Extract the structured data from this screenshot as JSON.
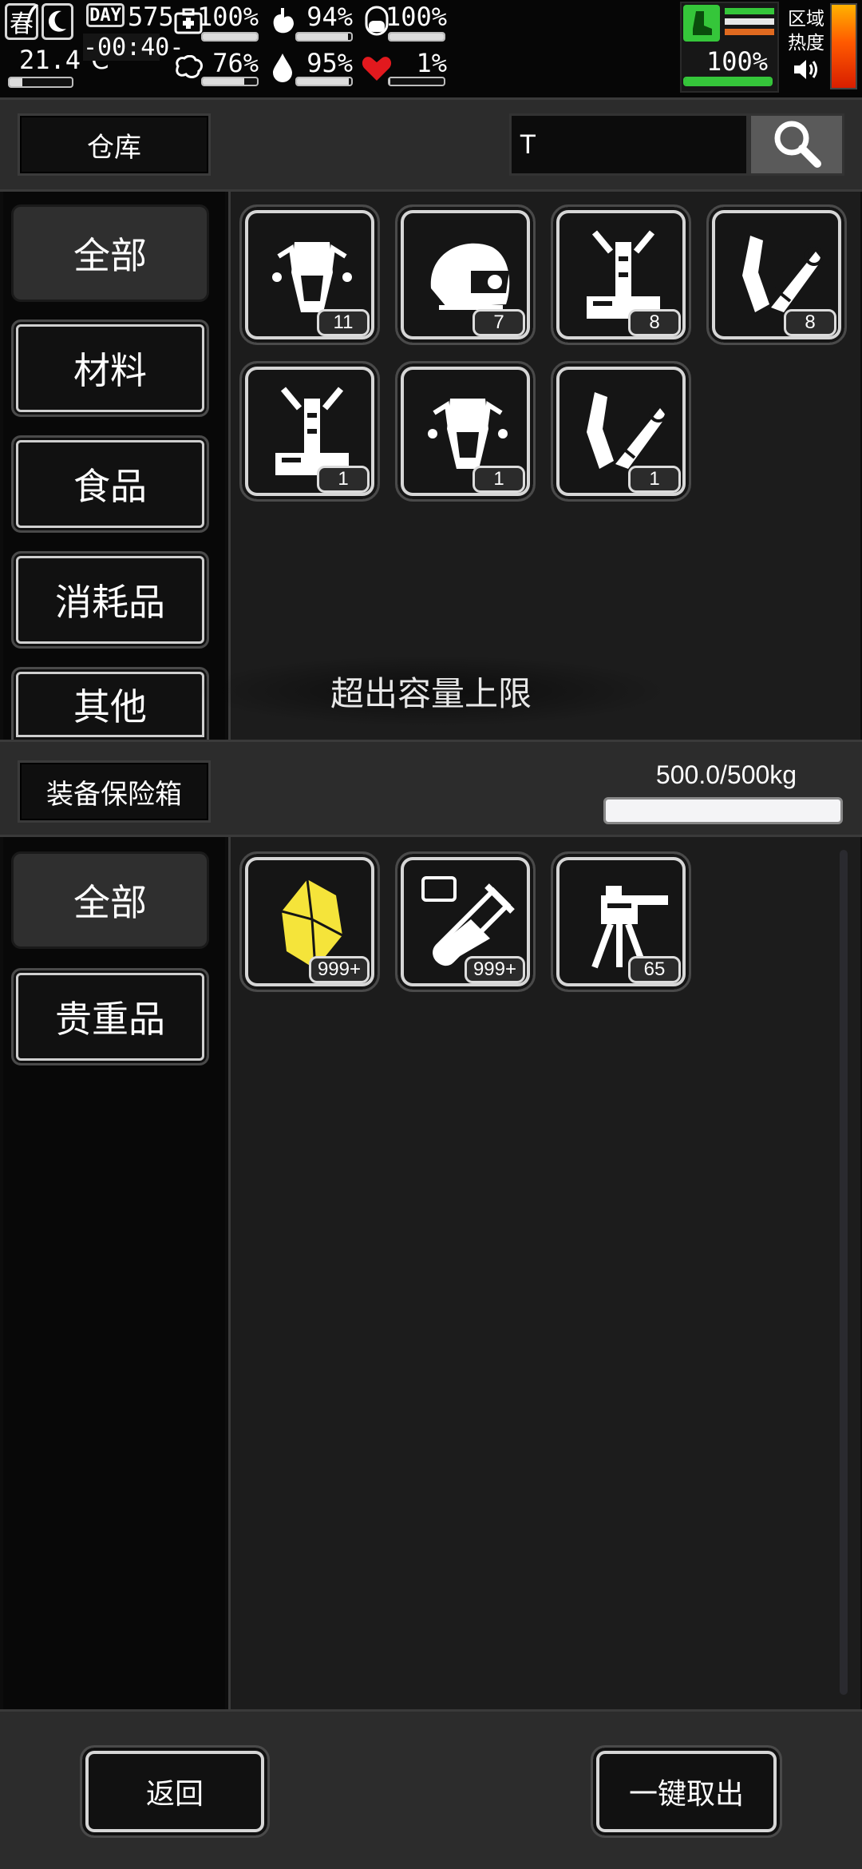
{
  "status": {
    "season": "春",
    "temperature": "21.4℃",
    "day_label": "DAY",
    "day_number": "575",
    "clock": "-00:40-",
    "zone_line1": "区域",
    "zone_line2": "热度",
    "stats": [
      {
        "icon": "medkit-icon",
        "value": "100%",
        "level": 1.0
      },
      {
        "icon": "stomach-icon",
        "value": "94%",
        "level": 0.94
      },
      {
        "icon": "pill-icon",
        "value": "100%",
        "level": 1.0
      },
      {
        "icon": "brain-icon",
        "value": "76%",
        "level": 0.76
      },
      {
        "icon": "water-drop-icon",
        "value": "95%",
        "level": 0.95
      },
      {
        "icon": "heart-icon",
        "value": "1%",
        "level": 0.01
      }
    ],
    "stamina": {
      "value": "100%",
      "level": 1.0,
      "color": "#35c63a"
    }
  },
  "warehouse": {
    "title": "仓库",
    "search_value": "T",
    "categories": [
      "全部",
      "材料",
      "食品",
      "消耗品",
      "其他"
    ],
    "items": [
      {
        "icon": "robot-claw-core-icon",
        "count": "11"
      },
      {
        "icon": "robot-helmet-icon",
        "count": "7"
      },
      {
        "icon": "mechanical-arm-base-icon",
        "count": "8"
      },
      {
        "icon": "mechanical-claw-limb-icon",
        "count": "8"
      },
      {
        "icon": "mechanical-arm-base-icon",
        "count": "1"
      },
      {
        "icon": "robot-claw-core-icon",
        "count": "1"
      },
      {
        "icon": "mechanical-claw-limb-icon",
        "count": "1"
      }
    ],
    "toast": "超出容量上限"
  },
  "safe_box": {
    "title": "装备保险箱",
    "weight": "500.0/500kg",
    "weight_level": 1.0,
    "categories": [
      "全部",
      "贵重品"
    ],
    "items": [
      {
        "icon": "yellow-crystal-icon",
        "count": "999+"
      },
      {
        "icon": "test-tube-vii-icon",
        "count": "999+"
      },
      {
        "icon": "turret-icon",
        "count": "65"
      }
    ]
  },
  "footer": {
    "back_label": "返回",
    "take_all_label": "一键取出"
  }
}
